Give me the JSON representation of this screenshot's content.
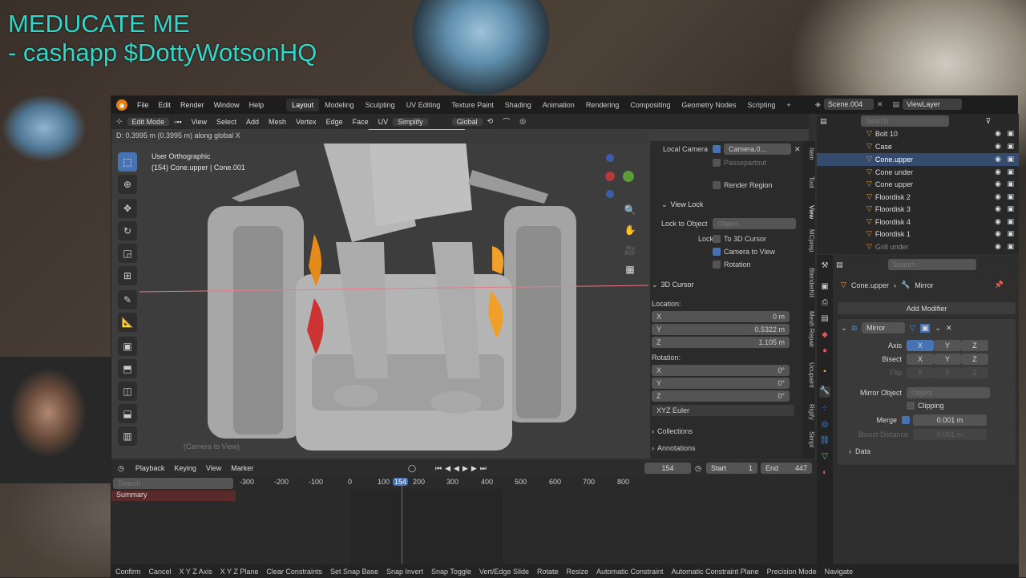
{
  "overlay": {
    "line1": "MEDUCATE ME",
    "line2": "- cashapp $DottyWotsonHQ"
  },
  "menu": {
    "file": "File",
    "edit": "Edit",
    "render": "Render",
    "window": "Window",
    "help": "Help"
  },
  "workspaces": [
    "Layout",
    "Modeling",
    "Sculpting",
    "UV Editing",
    "Texture Paint",
    "Shading",
    "Animation",
    "Rendering",
    "Compositing",
    "Geometry Nodes",
    "Scripting"
  ],
  "add_ws": "+",
  "scene": "Scene.004",
  "viewlayer": "ViewLayer",
  "viewport": {
    "mode": "Edit Mode",
    "view": "View",
    "select": "Select",
    "add": "Add",
    "mesh": "Mesh",
    "vertex": "Vertex",
    "edge": "Edge",
    "face": "Face",
    "uv": "UV",
    "simplify": "Simplify",
    "orientation": "Global",
    "status": "D: 0.3995 m (0.3995 m) along global X",
    "info1": "User Orthographic",
    "info2": "(154) Cone.upper | Cone.001",
    "hint": "(Camera to View)"
  },
  "npanel": {
    "local_camera": "Local Camera",
    "camera": "Camera.0...",
    "passepartout": "Passepartout",
    "render_region": "Render Region",
    "view_lock": "View Lock",
    "lock_to_object": "Lock to Object",
    "object_ph": "Object",
    "lock": "Lock",
    "to_3d_cursor": "To 3D Cursor",
    "camera_to_view": "Camera to View",
    "rotation_lbl": "Rotation",
    "cursor": "3D Cursor",
    "location": "Location:",
    "x": "X",
    "y": "Y",
    "z": "Z",
    "loc_x": "0 m",
    "loc_y": "0.5322 m",
    "loc_z": "1.105 m",
    "rotation": "Rotation:",
    "rot_x": "0°",
    "rot_y": "0°",
    "rot_z": "0°",
    "euler": "XYZ Euler",
    "collections": "Collections",
    "annotations": "Annotations"
  },
  "vtabs": [
    "Item",
    "Tool",
    "View",
    "MCprep",
    "BlenderKit",
    "Mesh Repair",
    "Ucupaint",
    "Rigify",
    "Simpl"
  ],
  "outliner": {
    "search": "Search",
    "rows": [
      "Bolt 10",
      "Case",
      "Cone.upper",
      "Cone under",
      "Cone upper",
      "Floordisk 2",
      "Floordisk 3",
      "Floordisk 4",
      "Floordisk 1",
      "Grill under"
    ]
  },
  "props": {
    "search": "Search",
    "obj": "Cone.upper",
    "mod": "Mirror",
    "add_modifier": "Add Modifier",
    "mod_name": "Mirror",
    "axis": "Axis",
    "bisect": "Bisect",
    "flip": "Flip",
    "ax": "X",
    "ay": "Y",
    "az": "Z",
    "mirror_object": "Mirror Object",
    "object_ph": "Object",
    "clipping": "Clipping",
    "merge": "Merge",
    "merge_val": "0.001 m",
    "bisect_distance": "Bisect Distance",
    "bisect_val": "0.001 m",
    "data": "Data"
  },
  "timeline": {
    "playback": "Playback",
    "keying": "Keying",
    "view": "View",
    "marker": "Marker",
    "frame": "154",
    "start_lbl": "Start",
    "start": "1",
    "end_lbl": "End",
    "end": "447",
    "search": "Search",
    "summary": "Summary",
    "ticks": [
      "-300",
      "-200",
      "-100",
      "0",
      "100",
      "200",
      "300",
      "400",
      "500",
      "600",
      "700",
      "800"
    ],
    "current": "154"
  },
  "statusbar": [
    "Confirm",
    "Cancel",
    "X Y Z Axis",
    "X Y Z Plane",
    "Clear Constraints",
    "Set Snap Base",
    "Snap Invert",
    "Snap Toggle",
    "Vert/Edge Slide",
    "Rotate",
    "Resize",
    "Automatic Constraint",
    "Automatic Constraint Plane",
    "Precision Mode",
    "Navigate"
  ]
}
